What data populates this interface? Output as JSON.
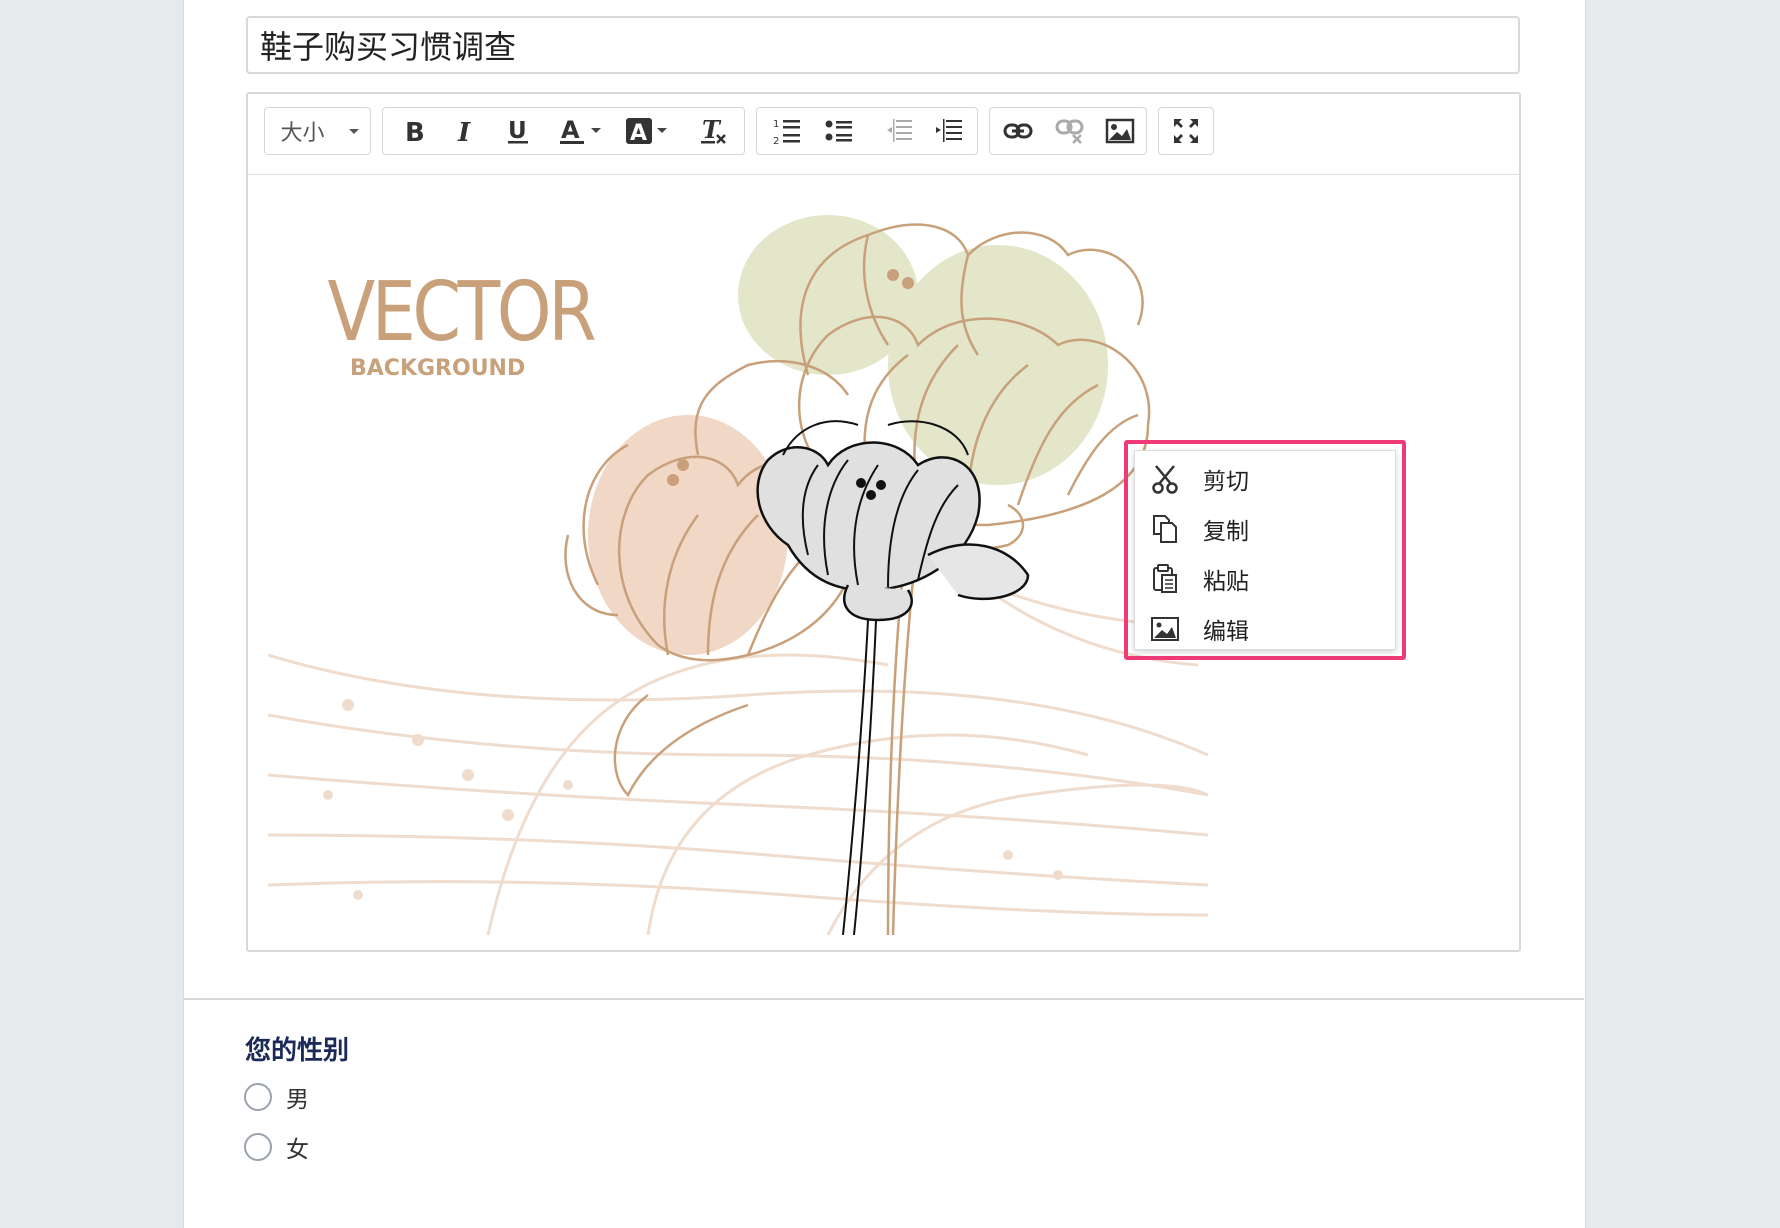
{
  "form": {
    "title_value": "鞋子购买习惯调查"
  },
  "toolbar": {
    "font_size_label": "大小",
    "groups": [
      [
        "font-size-dropdown"
      ],
      [
        "bold",
        "italic",
        "underline",
        "font-color",
        "background-color",
        "clear-format"
      ],
      [
        "ordered-list",
        "unordered-list",
        "outdent",
        "indent"
      ],
      [
        "link",
        "unlink",
        "image"
      ],
      [
        "fullscreen"
      ]
    ]
  },
  "image": {
    "logo_text": "VECTOR",
    "logo_subtext": "BACKGROUND",
    "colors": {
      "tan": "#c8a07a",
      "sage": "#e3e6c9",
      "peach": "#f0d7c6"
    }
  },
  "context_menu": {
    "items": [
      {
        "label": "剪切",
        "icon": "scissors-icon"
      },
      {
        "label": "复制",
        "icon": "copy-icon"
      },
      {
        "label": "粘贴",
        "icon": "paste-icon"
      },
      {
        "label": "编辑",
        "icon": "image-edit-icon"
      }
    ],
    "highlight_color": "#f03a78"
  },
  "question": {
    "title": "您的性别",
    "options": [
      "男",
      "女"
    ]
  }
}
